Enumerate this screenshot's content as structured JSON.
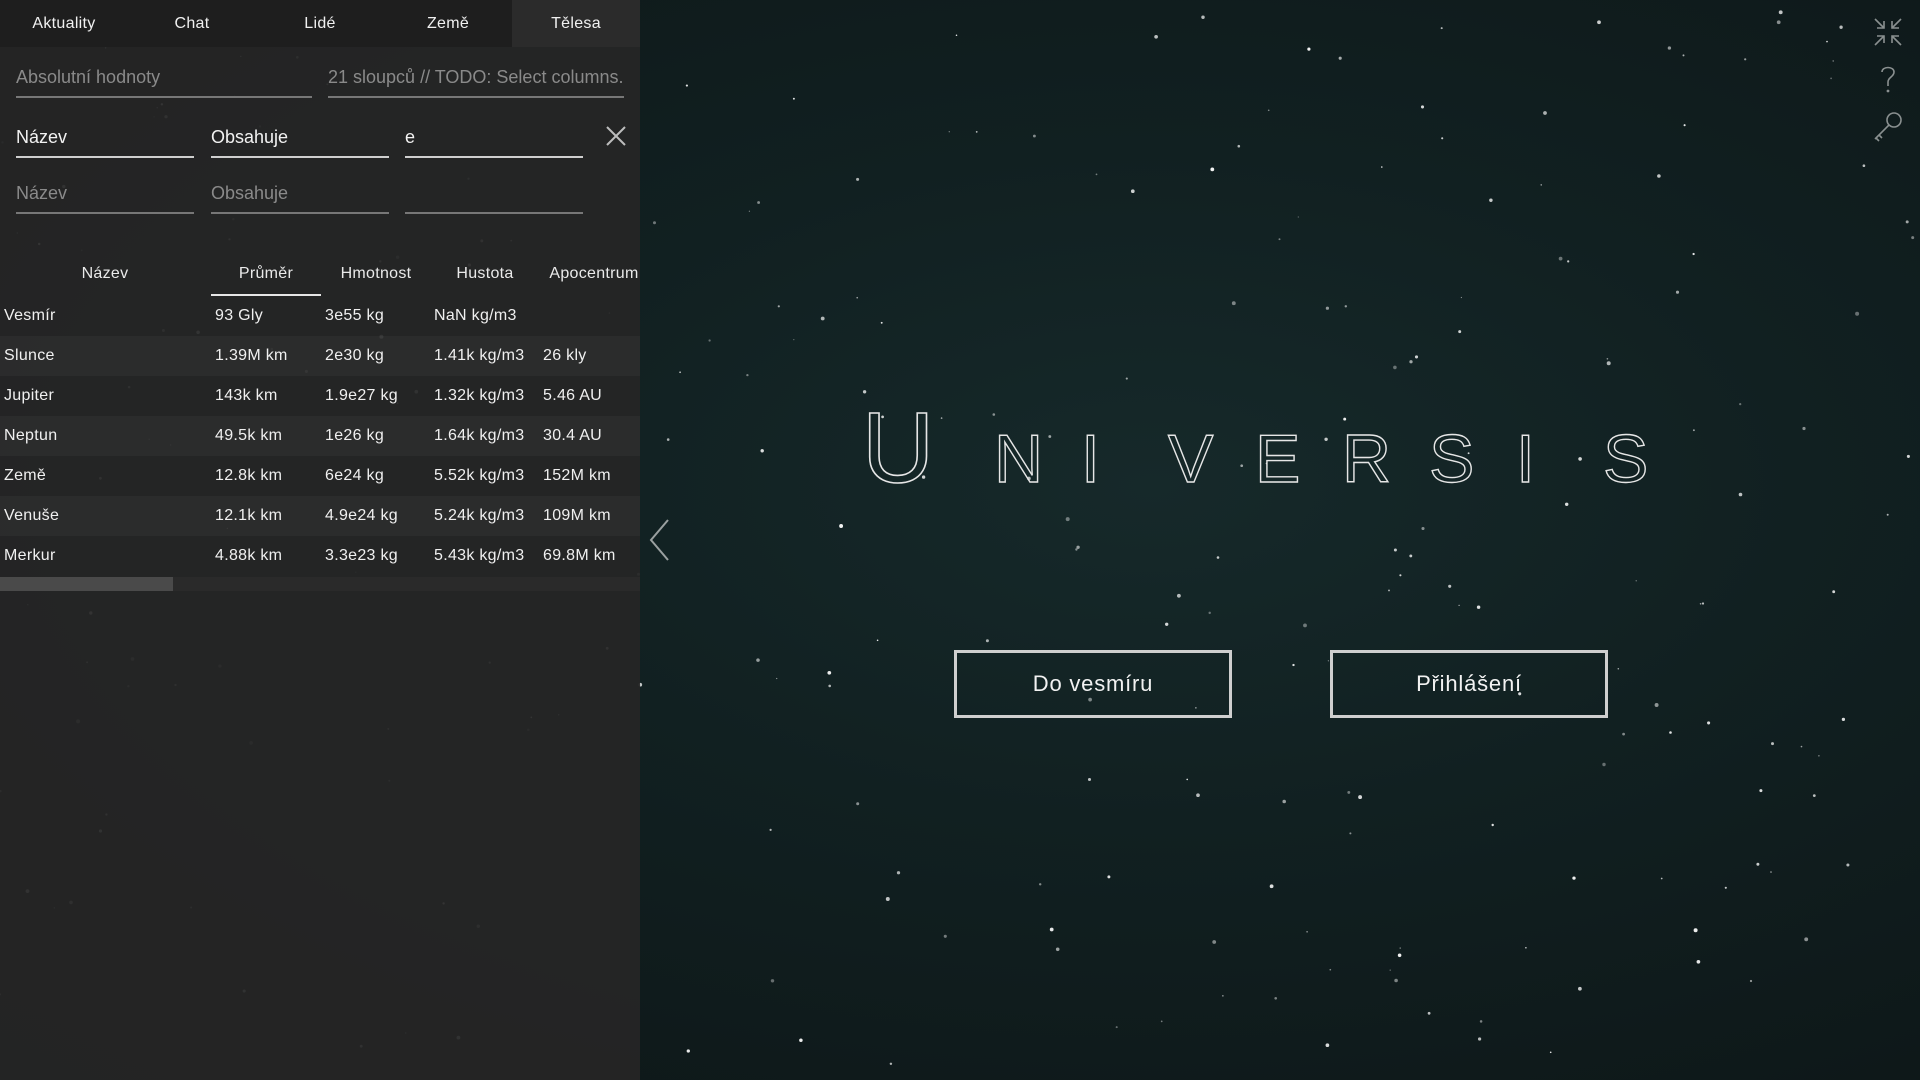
{
  "tabs": [
    {
      "label": "Aktuality",
      "active": false
    },
    {
      "label": "Chat",
      "active": false
    },
    {
      "label": "Lidé",
      "active": false
    },
    {
      "label": "Země",
      "active": false
    },
    {
      "label": "Tělesa",
      "active": true
    }
  ],
  "options": {
    "values_mode": "Absolutní hodnoty",
    "columns_info": "21 sloupců // TODO: Select columns."
  },
  "filters": [
    {
      "column": "Název",
      "operator": "Obsahuje",
      "value": "e",
      "active": true
    },
    {
      "column": "Název",
      "operator": "Obsahuje",
      "value": "",
      "active": false
    }
  ],
  "table": {
    "columns": [
      "Název",
      "Průměr",
      "Hmotnost",
      "Hustota",
      "Apocentrum"
    ],
    "sorted_column": "Průměr",
    "rows": [
      [
        "Vesmír",
        "93 Gly",
        "3e55 kg",
        "NaN kg/m3",
        ""
      ],
      [
        "Slunce",
        "1.39M km",
        "2e30 kg",
        "1.41k kg/m3",
        "26 kly"
      ],
      [
        "Jupiter",
        "143k km",
        "1.9e27 kg",
        "1.32k kg/m3",
        "5.46 AU"
      ],
      [
        "Neptun",
        "49.5k km",
        "1e26 kg",
        "1.64k kg/m3",
        "30.4 AU"
      ],
      [
        "Země",
        "12.8k km",
        "6e24 kg",
        "5.52k kg/m3",
        "152M km"
      ],
      [
        "Venuše",
        "12.1k km",
        "4.9e24 kg",
        "5.24k kg/m3",
        "109M km"
      ],
      [
        "Merkur",
        "4.88k km",
        "3.3e23 kg",
        "5.43k kg/m3",
        "69.8M km"
      ]
    ],
    "horizontal_scroll_fraction": 0.27
  },
  "logo_text": "UNIVERSIS",
  "buttons": {
    "enter": "Do vesmíru",
    "login": "Přihlášení"
  },
  "icons": {
    "collapse_panel": "chevron-left-icon",
    "fullscreen": "compress-icon",
    "help": "question-mark-icon",
    "key": "key-icon",
    "clear": "close-icon"
  },
  "colors": {
    "background": "#112021",
    "panel": "#262626",
    "text": "#f0f0f0",
    "muted": "#8a8a8a"
  }
}
